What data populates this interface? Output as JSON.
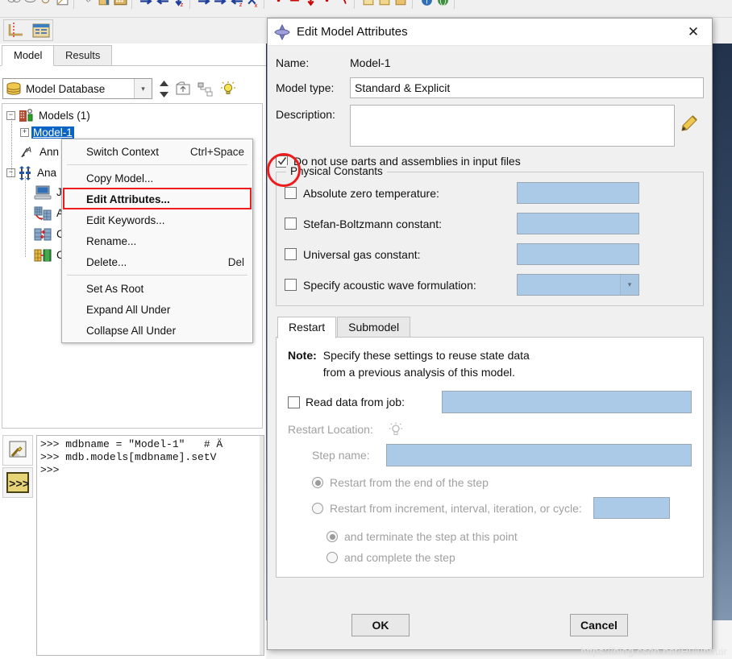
{
  "app": {
    "module_tabs": [
      {
        "label": "Model",
        "selected": true
      },
      {
        "label": "Results",
        "selected": false
      }
    ],
    "database_combo": {
      "value": "Model Database",
      "icon": "database-icon",
      "arrow_glyph": "⌵"
    },
    "toolbar_icons": [
      "up-one-level-icon",
      "filter-tree-icon",
      "lightbulb-icon"
    ],
    "tree": {
      "nodes": [
        {
          "label": "Models (1)",
          "indent": 0,
          "expander": "minus",
          "icon": "models-icon"
        },
        {
          "label": "Model-1",
          "indent": 1,
          "expander": "plus",
          "icon": "model-icon",
          "selected": true
        },
        {
          "label": "Ann",
          "indent": 0,
          "expander": "none",
          "icon": "annotations-icon"
        },
        {
          "label": "Ana",
          "indent": 0,
          "expander": "minus",
          "icon": "analysis-icon"
        },
        {
          "label": "J",
          "indent": 1,
          "expander": "none",
          "icon": "jobs-icon"
        },
        {
          "label": "A",
          "indent": 1,
          "expander": "none",
          "icon": "adaptivity-icon"
        },
        {
          "label": "C",
          "indent": 1,
          "expander": "none",
          "icon": "cosimulation-icon"
        },
        {
          "label": "C",
          "indent": 1,
          "expander": "none",
          "icon": "optimization-icon"
        }
      ]
    },
    "console": {
      "buttons": [
        "message-area-icon",
        "command-line-interface-icon"
      ],
      "lines": [
        ">>> mdbname = \"Model-1\"   # Ä",
        ">>> mdb.models[mdbname].setV",
        ">>>"
      ]
    }
  },
  "context_menu": {
    "items": [
      {
        "label": "Switch Context",
        "accel": "Ctrl+Space",
        "bold": false,
        "sep_after": true
      },
      {
        "label": "Copy Model...",
        "accel": "",
        "bold": false,
        "sep_after": false
      },
      {
        "label": "Edit Attributes...",
        "accel": "",
        "bold": true,
        "highlighted": true,
        "sep_after": false
      },
      {
        "label": "Edit Keywords...",
        "accel": "",
        "bold": false,
        "sep_after": false
      },
      {
        "label": "Rename...",
        "accel": "",
        "bold": false,
        "sep_after": false
      },
      {
        "label": "Delete...",
        "accel": "Del",
        "bold": false,
        "sep_after": true
      },
      {
        "label": "Set As Root",
        "accel": "",
        "bold": false,
        "sep_after": false
      },
      {
        "label": "Expand All Under",
        "accel": "",
        "bold": false,
        "sep_after": false
      },
      {
        "label": "Collapse All Under",
        "accel": "",
        "bold": false,
        "sep_after": false
      }
    ]
  },
  "dialog": {
    "title": "Edit Model Attributes",
    "title_icon": "abaqus-logo-icon",
    "close_glyph": "✕",
    "name_label": "Name:",
    "name_value": "Model-1",
    "model_type_label": "Model type:",
    "model_type_value": "Standard & Explicit",
    "description_label": "Description:",
    "description_value": "",
    "description_edit_icon": "pencil-icon",
    "no_parts_checkbox": {
      "label": "Do not use parts and assemblies in input files",
      "checked": true
    },
    "physical_constants": {
      "legend": "Physical Constants",
      "rows": [
        {
          "label": "Absolute zero temperature:",
          "checked": false,
          "value": "",
          "control": "text"
        },
        {
          "label": "Stefan-Boltzmann constant:",
          "checked": false,
          "value": "",
          "control": "text"
        },
        {
          "label": "Universal gas constant:",
          "checked": false,
          "value": "",
          "control": "text"
        },
        {
          "label": "Specify acoustic wave formulation:",
          "checked": false,
          "value": "",
          "control": "combo"
        }
      ]
    },
    "tabs": [
      {
        "label": "Restart",
        "selected": true
      },
      {
        "label": "Submodel",
        "selected": false
      }
    ],
    "restart": {
      "note_label": "Note:",
      "note_line1": "Specify these settings to reuse state data",
      "note_line2": "from a previous analysis of this model.",
      "read_job_label": "Read data from job:",
      "read_job_checked": false,
      "read_job_value": "",
      "restart_location_label": "Restart Location:",
      "restart_location_icon": "lightbulb-icon",
      "step_name_label": "Step name:",
      "step_name_value": "",
      "radio_end_of_step": {
        "label": "Restart from the end of the step",
        "selected": true
      },
      "radio_increment": {
        "label": "Restart from increment, interval, iteration, or cycle:",
        "selected": false,
        "value": ""
      },
      "radio_terminate": {
        "label": "and terminate the step at this point",
        "selected": true
      },
      "radio_complete": {
        "label": "and complete the step",
        "selected": false
      }
    },
    "ok_label": "OK",
    "cancel_label": "Cancel"
  },
  "watermark": "https://blog.csdn.net/Hulunbuir",
  "colors": {
    "accent_blue": "#abcae8",
    "selection_blue": "#0a64c8",
    "annotation_red": "#ee1c1c",
    "dialog_bg": "#f0f0f0"
  }
}
